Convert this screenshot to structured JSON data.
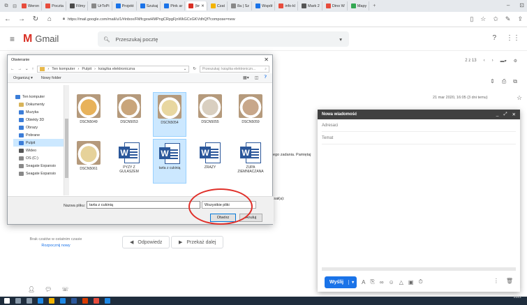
{
  "browser": {
    "tabs": [
      {
        "label": "Weron",
        "color": "#e74c3c"
      },
      {
        "label": "Poczta",
        "color": "#e74c3c"
      },
      {
        "label": "Filmy",
        "color": "#4a4a4a"
      },
      {
        "label": "UrToPi",
        "color": "#888888"
      },
      {
        "label": "Projekt",
        "color": "#1a73e8"
      },
      {
        "label": "Szukaj",
        "color": "#1a73e8"
      },
      {
        "label": "Pink ar",
        "color": "#1a73e8"
      },
      {
        "label": "(br",
        "color": "#d93025",
        "active": true
      },
      {
        "label": "Czat",
        "color": "#f4b400"
      },
      {
        "label": "8a | Sz",
        "color": "#888888"
      },
      {
        "label": "Współ",
        "color": "#1a73e8"
      },
      {
        "label": "info-kl",
        "color": "#e74c3c"
      },
      {
        "label": "Mark 2",
        "color": "#555555"
      },
      {
        "label": "Dino W",
        "color": "#e74c3c"
      },
      {
        "label": "Mapy",
        "color": "#34a853"
      }
    ],
    "url": "https://mail.google.com/mail/u/1/#inbox/FMfcgxwHMPngCRpgFjnWkGCxGKVdhQf?compose=new"
  },
  "gmail": {
    "logo": "Gmail",
    "search_placeholder": "Przeszukaj pocztę",
    "pagination": "2 z 13",
    "date": "21 mar 2020, 16:05 (3 dni temu)",
    "body_line1": "ego zadania. Pamiętaj",
    "body_line2": "isał(a):",
    "reply_label": "Odpowiedz",
    "forward_label": "Przekaż dalej",
    "chat_empty": "Brak czatów w ostatnim czasie",
    "chat_start": "Rozpocznij nowy"
  },
  "compose": {
    "title": "Nowa wiadomość",
    "to_placeholder": "Adresaci",
    "subject_placeholder": "Temat",
    "send_label": "Wyślij"
  },
  "dialog": {
    "title": "Otwieranie",
    "breadcrumb": [
      "Ten komputer",
      "Pulpit",
      "książka elektroniczna"
    ],
    "search_placeholder": "Przeszukaj: książka elektroniczn...",
    "organize": "Organizuj ▾",
    "new_folder": "Nowy folder",
    "tree": [
      {
        "label": "Ten komputer",
        "color": "#3b7dd8"
      },
      {
        "label": "Dokumenty",
        "color": "#d8b45a"
      },
      {
        "label": "Muzyka",
        "color": "#3b7dd8"
      },
      {
        "label": "Obiekty 3D",
        "color": "#3b7dd8"
      },
      {
        "label": "Obrazy",
        "color": "#3b7dd8"
      },
      {
        "label": "Pobrane",
        "color": "#3b7dd8"
      },
      {
        "label": "Pulpit",
        "color": "#3b7dd8",
        "selected": true
      },
      {
        "label": "Wideo",
        "color": "#555555"
      },
      {
        "label": "OS (C:)",
        "color": "#888888"
      },
      {
        "label": "Seagate Expansio",
        "color": "#888888"
      },
      {
        "label": "Seagate Expansio",
        "color": "#888888"
      }
    ],
    "files": [
      {
        "name": "DSCN5049",
        "type": "photo",
        "color": "#e8b25a"
      },
      {
        "name": "DSCN5053",
        "type": "photo",
        "color": "#c9a57a"
      },
      {
        "name": "DSCN5054",
        "type": "photo",
        "color": "#e8d7a0",
        "selected": true
      },
      {
        "name": "DSCN5055",
        "type": "photo",
        "color": "#d9cfc0"
      },
      {
        "name": "DSCN5059",
        "type": "photo",
        "color": "#c8a78a"
      },
      {
        "name": "DSCN5061",
        "type": "photo",
        "color": "#e6d29a"
      },
      {
        "name": "PYZY Z GULASZEM",
        "type": "word"
      },
      {
        "name": "tarta z cukinią",
        "type": "word",
        "selected": true
      },
      {
        "name": "ZRAZY",
        "type": "word"
      },
      {
        "name": "ZUPA ZIEMNIACZANA",
        "type": "word"
      }
    ],
    "filename_label": "Nazwa pliku:",
    "filename_value": "tarta z cukinią",
    "filetype": "Wszystkie pliki",
    "open_label": "Otwórz",
    "cancel_label": "Anuluj"
  },
  "taskbar": {
    "clock": "2022"
  }
}
